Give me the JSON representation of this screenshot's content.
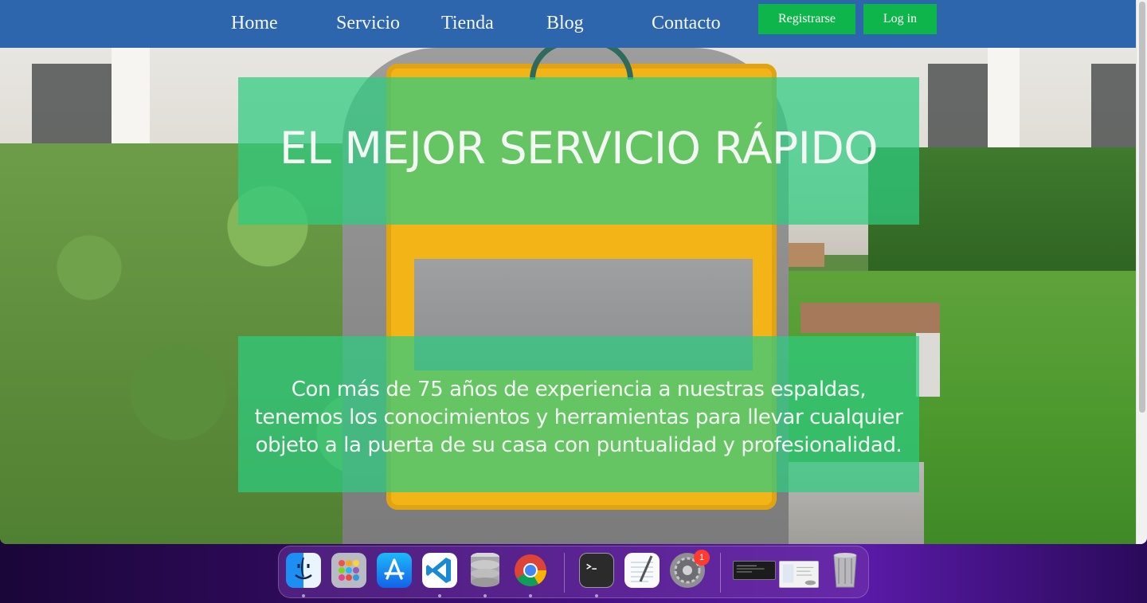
{
  "nav": {
    "links": [
      "Home",
      "Servicio",
      "Tienda",
      "Blog",
      "Contacto"
    ],
    "register_label": "Registrarse",
    "login_label": "Log in"
  },
  "hero": {
    "title": "EL MEJOR SERVICIO RÁPIDO",
    "description": "Con más de 75 años de experiencia a nuestras espaldas, tenemos los conocimientos y herramientas para llevar cualquier objeto a la puerta de su casa con puntualidad y profesionalidad."
  },
  "colors": {
    "nav_bg": "#2d66ad",
    "button_bg": "#0db54a",
    "panel_bg": "rgba(46, 204, 128, 0.72)",
    "panel_text": "#f4f8f5"
  },
  "dock": {
    "apps": [
      {
        "icon": "finder-icon"
      },
      {
        "icon": "launchpad-icon"
      },
      {
        "icon": "app-store-icon"
      },
      {
        "icon": "vscode-icon"
      },
      {
        "icon": "database-icon"
      },
      {
        "icon": "chrome-icon"
      },
      {
        "icon": "terminal-icon"
      },
      {
        "icon": "textedit-icon"
      },
      {
        "icon": "system-preferences-icon",
        "badge": "1"
      },
      {
        "icon": "terminal-window-thumbnail-icon"
      },
      {
        "icon": "app-window-thumbnail-icon"
      },
      {
        "icon": "trash-icon"
      }
    ]
  }
}
